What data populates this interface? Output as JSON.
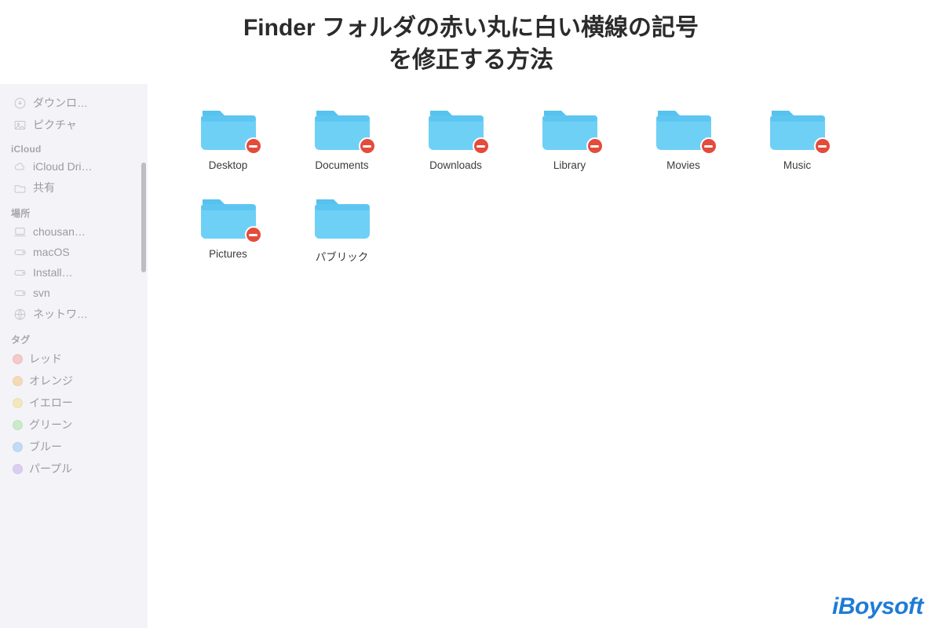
{
  "title": {
    "line1": "Finder フォルダの赤い丸に白い横線の記号",
    "line2": "を修正する方法"
  },
  "sidebar": {
    "favorites": [
      {
        "icon": "download-icon",
        "label": "ダウンロ…"
      },
      {
        "icon": "picture-icon",
        "label": "ピクチャ"
      }
    ],
    "icloud_header": "iCloud",
    "icloud": [
      {
        "icon": "cloud-icon",
        "label": "iCloud Dri…"
      },
      {
        "icon": "shared-icon",
        "label": "共有"
      }
    ],
    "locations_header": "場所",
    "locations": [
      {
        "icon": "laptop-icon",
        "label": "chousan…"
      },
      {
        "icon": "disk-icon",
        "label": "macOS"
      },
      {
        "icon": "disk-icon",
        "label": "Install…"
      },
      {
        "icon": "disk-icon",
        "label": "svn"
      },
      {
        "icon": "network-icon",
        "label": "ネットワ…"
      }
    ],
    "tags_header": "タグ",
    "tags": [
      {
        "color": "#f4a6a0",
        "label": "レッド"
      },
      {
        "color": "#f6c585",
        "label": "オレンジ"
      },
      {
        "color": "#f3e08a",
        "label": "イエロー"
      },
      {
        "color": "#a8e3a1",
        "label": "グリーン"
      },
      {
        "color": "#9cc6f4",
        "label": "ブルー"
      },
      {
        "color": "#c9aef0",
        "label": "パープル"
      }
    ]
  },
  "folders": [
    {
      "name": "Desktop",
      "restricted": true
    },
    {
      "name": "Documents",
      "restricted": true
    },
    {
      "name": "Downloads",
      "restricted": true
    },
    {
      "name": "Library",
      "restricted": true
    },
    {
      "name": "Movies",
      "restricted": true
    },
    {
      "name": "Music",
      "restricted": true
    },
    {
      "name": "Pictures",
      "restricted": true
    },
    {
      "name": "パブリック",
      "restricted": false
    }
  ],
  "watermark": "iBoysoft"
}
